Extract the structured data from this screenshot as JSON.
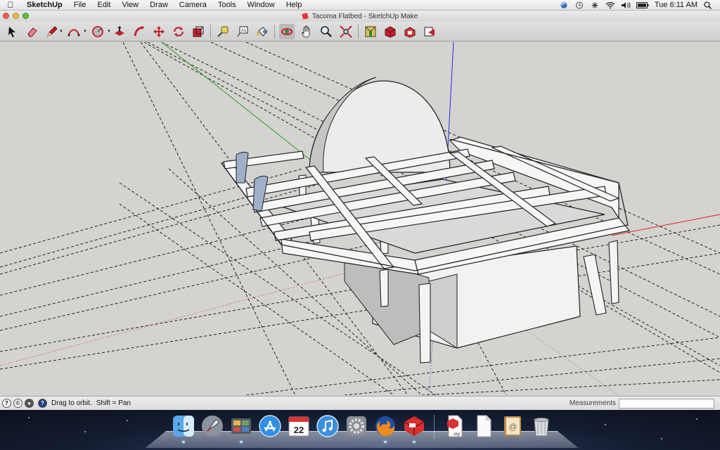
{
  "menubar": {
    "app_name": "SketchUp",
    "menus": [
      "File",
      "Edit",
      "View",
      "Draw",
      "Camera",
      "Tools",
      "Window",
      "Help"
    ],
    "clock": "Tue 6:11 AM"
  },
  "window": {
    "title": "Tacoma Flatbed - SketchUp Make"
  },
  "toolbar": {
    "tools": [
      "select-tool",
      "eraser-tool",
      "pencil-line-tool",
      "arc-tool",
      "circle-tool",
      "push-pull-tool",
      "follow-me-tool",
      "move-tool",
      "rotate-tool",
      "scale-tool",
      "tape-measure-tool",
      "text-tool",
      "paint-bucket-tool",
      "orbit-tool",
      "pan-tool",
      "zoom-tool",
      "zoom-extents-tool",
      "components-tool",
      "warehouse-tool",
      "extension-warehouse-tool",
      "share-model-tool"
    ]
  },
  "statusbar": {
    "hint": "Drag to orbit.",
    "hint_shift": "Shift = Pan",
    "measurements_label": "Measurements",
    "measurements_value": ""
  },
  "dock": {
    "apps": [
      "Finder",
      "Launchpad",
      "Photo Browser",
      "App Store",
      "Calendar",
      "iTunes",
      "System Preferences",
      "Firefox",
      "SketchUp"
    ],
    "calendar_day": "22",
    "docs": [
      "skp document",
      "blank document",
      "Contacts",
      "Trash"
    ],
    "skp_label": ".skp"
  },
  "colors": {
    "viewport_bg": "#d5d3d0",
    "axis_red": "#d9221c",
    "axis_green": "#21a121",
    "axis_blue": "#2330d6",
    "accent_red": "#c8202a"
  }
}
